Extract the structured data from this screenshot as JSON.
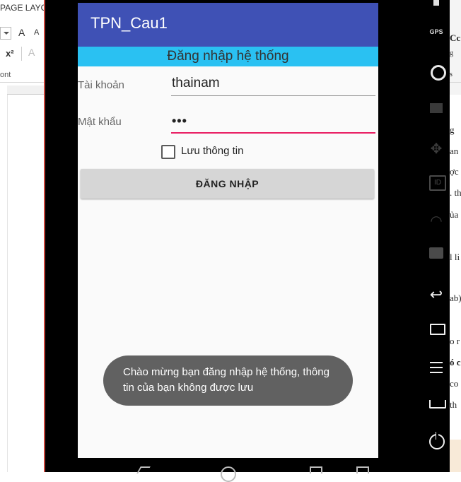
{
  "word_left": {
    "tab_label": "PAGE LAYOUT",
    "grow_font": "A",
    "shrink_font": "A",
    "superscript": "x²",
    "text_effects": "A",
    "group_label": "ont"
  },
  "app": {
    "title": "TPN_Cau1",
    "banner": "Đăng nhập hệ thống",
    "username_label": "Tài khoản",
    "username_value": "thainam",
    "password_label": "Mật khẩu",
    "password_value": "•••",
    "remember_label": "Lưu thông tin",
    "login_button": "ĐĂNG NHẬP",
    "toast": "Chào mừng bạn đăng nhập hệ thống, thông tin của bạn không được lưu"
  },
  "emulator_toolbar": {
    "gps_label": "GPS",
    "id_label": "ID",
    "back_glyph": "↩"
  },
  "word_right": {
    "lines": [
      "Cc",
      "g",
      "g",
      "s",
      "g",
      "an",
      "ợc l",
      ". th",
      "ủa",
      "l li",
      "ab)",
      "o r",
      "ó c",
      " co",
      " th"
    ]
  },
  "colors": {
    "app_bar": "#3f51b5",
    "banner": "#2ac1f2",
    "password_underline": "#e91e63",
    "toast": "#616161"
  }
}
